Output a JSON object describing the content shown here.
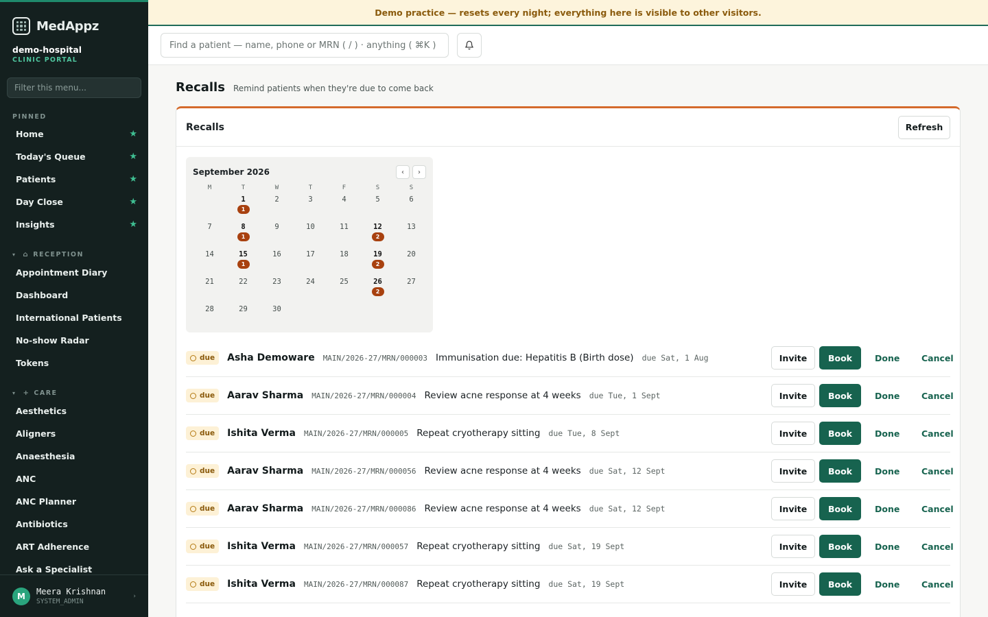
{
  "brand": {
    "name": "MedAppz"
  },
  "org": {
    "name": "demo-hospital",
    "subtitle": "CLINIC PORTAL"
  },
  "sidebar": {
    "filter_placeholder": "Filter this menu...",
    "pinned_label": "PINNED",
    "pinned": [
      {
        "label": "Home"
      },
      {
        "label": "Today's Queue"
      },
      {
        "label": "Patients"
      },
      {
        "label": "Day Close"
      },
      {
        "label": "Insights"
      }
    ],
    "reception_label": "RECEPTION",
    "reception": [
      {
        "label": "Appointment Diary"
      },
      {
        "label": "Dashboard"
      },
      {
        "label": "International Patients"
      },
      {
        "label": "No-show Radar"
      },
      {
        "label": "Tokens"
      }
    ],
    "care_label": "CARE",
    "care": [
      {
        "label": "Aesthetics"
      },
      {
        "label": "Aligners"
      },
      {
        "label": "Anaesthesia"
      },
      {
        "label": "ANC"
      },
      {
        "label": "ANC Planner"
      },
      {
        "label": "Antibiotics"
      },
      {
        "label": "ART Adherence"
      },
      {
        "label": "Ask a Specialist"
      }
    ]
  },
  "user": {
    "initial": "M",
    "name": "Meera Krishnan",
    "role": "SYSTEM_ADMIN"
  },
  "banner": {
    "text": "Demo practice — resets every night; everything here is visible to other visitors."
  },
  "search": {
    "placeholder": "Find a patient — name, phone or MRN ( / ) · anything ( ⌘K )"
  },
  "page": {
    "title": "Recalls",
    "subtitle": "Remind patients when they're due to come back"
  },
  "card": {
    "title": "Recalls",
    "refresh_label": "Refresh"
  },
  "calendar": {
    "month": "September 2026",
    "prev": "‹",
    "next": "›",
    "weekdays": [
      "M",
      "T",
      "W",
      "T",
      "F",
      "S",
      "S"
    ],
    "leading_blanks": 1,
    "days": [
      {
        "d": "1",
        "count": "1"
      },
      {
        "d": "2"
      },
      {
        "d": "3"
      },
      {
        "d": "4"
      },
      {
        "d": "5"
      },
      {
        "d": "6"
      },
      {
        "d": "7"
      },
      {
        "d": "8",
        "count": "1"
      },
      {
        "d": "9"
      },
      {
        "d": "10"
      },
      {
        "d": "11"
      },
      {
        "d": "12",
        "count": "2"
      },
      {
        "d": "13"
      },
      {
        "d": "14"
      },
      {
        "d": "15",
        "count": "1"
      },
      {
        "d": "16"
      },
      {
        "d": "17"
      },
      {
        "d": "18"
      },
      {
        "d": "19",
        "count": "2"
      },
      {
        "d": "20"
      },
      {
        "d": "21"
      },
      {
        "d": "22"
      },
      {
        "d": "23"
      },
      {
        "d": "24"
      },
      {
        "d": "25"
      },
      {
        "d": "26",
        "count": "2"
      },
      {
        "d": "27"
      },
      {
        "d": "28"
      },
      {
        "d": "29"
      },
      {
        "d": "30"
      }
    ]
  },
  "actions": {
    "invite": "Invite",
    "book": "Book",
    "done": "Done",
    "cancel": "Cancel"
  },
  "recalls": [
    {
      "status": "due",
      "name": "Asha Demoware",
      "mrn": "MAIN/2026-27/MRN/000003",
      "reason": "Immunisation due: Hepatitis B (Birth dose)",
      "due": "due Sat, 1 Aug"
    },
    {
      "status": "due",
      "name": "Aarav Sharma",
      "mrn": "MAIN/2026-27/MRN/000004",
      "reason": "Review acne response at 4 weeks",
      "due": "due Tue, 1 Sept"
    },
    {
      "status": "due",
      "name": "Ishita Verma",
      "mrn": "MAIN/2026-27/MRN/000005",
      "reason": "Repeat cryotherapy sitting",
      "due": "due Tue, 8 Sept"
    },
    {
      "status": "due",
      "name": "Aarav Sharma",
      "mrn": "MAIN/2026-27/MRN/000056",
      "reason": "Review acne response at 4 weeks",
      "due": "due Sat, 12 Sept"
    },
    {
      "status": "due",
      "name": "Aarav Sharma",
      "mrn": "MAIN/2026-27/MRN/000086",
      "reason": "Review acne response at 4 weeks",
      "due": "due Sat, 12 Sept"
    },
    {
      "status": "due",
      "name": "Ishita Verma",
      "mrn": "MAIN/2026-27/MRN/000057",
      "reason": "Repeat cryotherapy sitting",
      "due": "due Sat, 19 Sept"
    },
    {
      "status": "due",
      "name": "Ishita Verma",
      "mrn": "MAIN/2026-27/MRN/000087",
      "reason": "Repeat cryotherapy sitting",
      "due": "due Sat, 19 Sept"
    }
  ],
  "colors": {
    "accent": "#17634f",
    "brand_green": "#1f8a6c",
    "card_top": "#d46a2b",
    "badge": "#a8410f",
    "sidebar_bg": "#14201f",
    "banner_bg": "#fdf4dc"
  }
}
